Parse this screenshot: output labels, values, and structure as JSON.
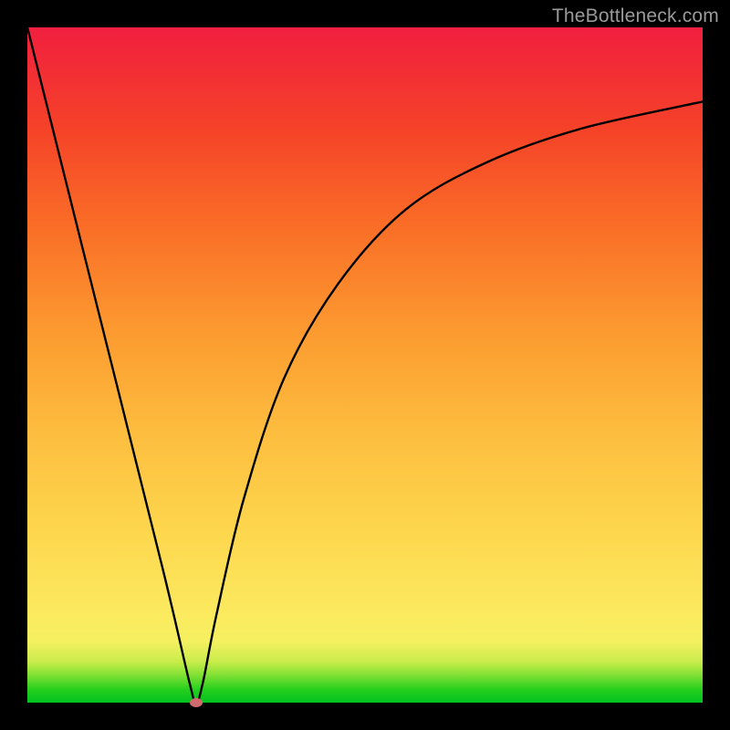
{
  "watermark": "TheBottleneck.com",
  "chart_data": {
    "type": "line",
    "title": "",
    "xlabel": "",
    "ylabel": "",
    "xlim": [
      0,
      100
    ],
    "ylim": [
      0,
      100
    ],
    "grid": false,
    "series": [
      {
        "name": "bottleneck-curve",
        "x": [
          0,
          10,
          20,
          24,
          25,
          26,
          28,
          32,
          38,
          46,
          56,
          68,
          82,
          100
        ],
        "values": [
          100,
          60,
          20,
          3,
          0,
          3,
          13,
          30,
          48,
          62,
          73,
          80,
          85,
          89
        ]
      }
    ],
    "annotations": [
      {
        "name": "min-marker",
        "x": 25,
        "y": 0
      }
    ],
    "background_gradient": {
      "direction": "vertical",
      "stops": [
        {
          "pos": 0,
          "color": "#00c31e"
        },
        {
          "pos": 9,
          "color": "#f4f060"
        },
        {
          "pos": 55,
          "color": "#fc9a30"
        },
        {
          "pos": 100,
          "color": "#f11f3f"
        }
      ]
    }
  }
}
